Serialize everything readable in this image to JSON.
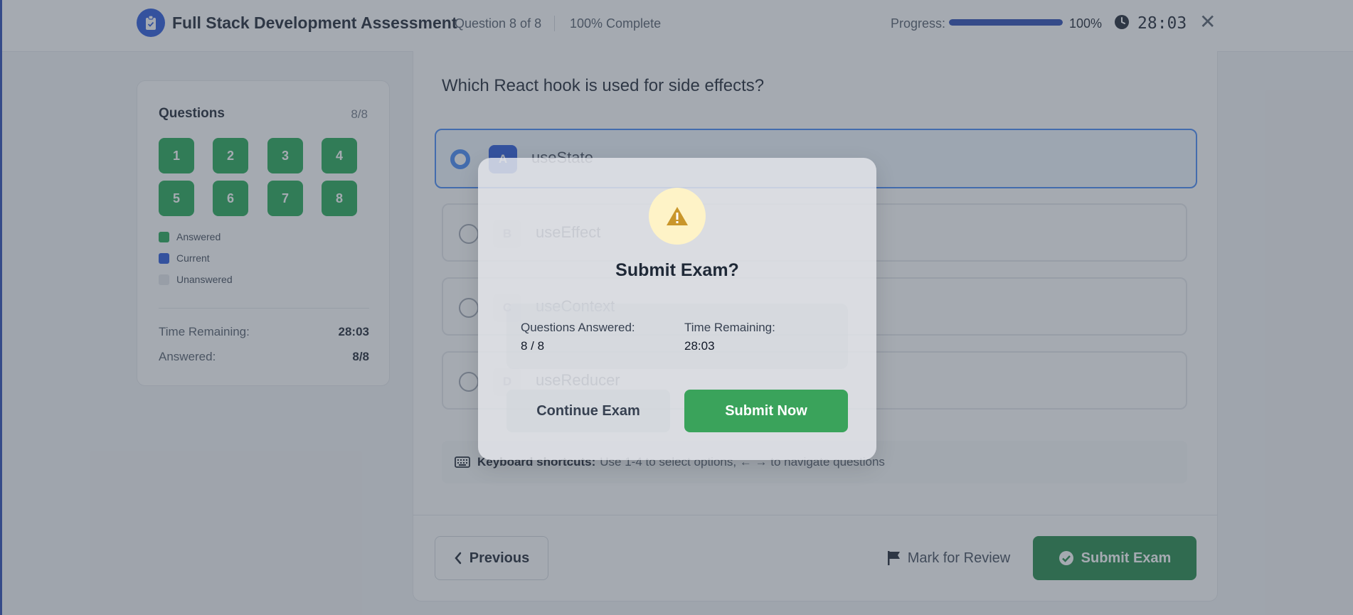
{
  "header": {
    "title": "Full Stack Development Assessment",
    "question_of": "Question 8 of 8",
    "complete_text": "100% Complete",
    "progress_label": "Progress:",
    "progress_value": 1.0,
    "progress_pct_text": "100%",
    "timer": "28:03",
    "close_glyph": "✕",
    "icons": [
      "clipboard-icon",
      "clock-icon",
      "close-icon"
    ],
    "accent_color": "#1e40af"
  },
  "sidebar": {
    "title": "Questions",
    "count": "8/8",
    "question_numbers": [
      "1",
      "2",
      "3",
      "4",
      "5",
      "6",
      "7",
      "8"
    ],
    "legend": [
      {
        "label": "Answered",
        "color": "#16a34a"
      },
      {
        "label": "Current",
        "color": "#1d4ed8"
      },
      {
        "label": "Unanswered",
        "color": "#e5e7eb"
      }
    ],
    "time_remaining_label": "Time Remaining:",
    "time_remaining_value": "28:03",
    "answered_label": "Answered:",
    "answered_value": "8/8"
  },
  "main": {
    "question": "Which React hook is used for side effects?",
    "options": [
      {
        "letter": "A",
        "text": "useState",
        "selected": true
      },
      {
        "letter": "B",
        "text": "useEffect",
        "selected": false
      },
      {
        "letter": "C",
        "text": "useContext",
        "selected": false
      },
      {
        "letter": "D",
        "text": "useReducer",
        "selected": false
      }
    ],
    "shortcuts_label": "Keyboard shortcuts:",
    "shortcuts_text": "Use 1-4 to select options, ← → to navigate questions",
    "previous_label": "Previous",
    "review_label": "Mark for Review",
    "submit_label": "Submit Exam"
  },
  "modal": {
    "title": "Submit Exam?",
    "answered_label": "Questions Answered:",
    "answered_value": "8 / 8",
    "time_label": "Time Remaining:",
    "time_value": "28:03",
    "continue_label": "Continue Exam",
    "submit_label": "Submit Now",
    "icon": "warning-icon"
  }
}
